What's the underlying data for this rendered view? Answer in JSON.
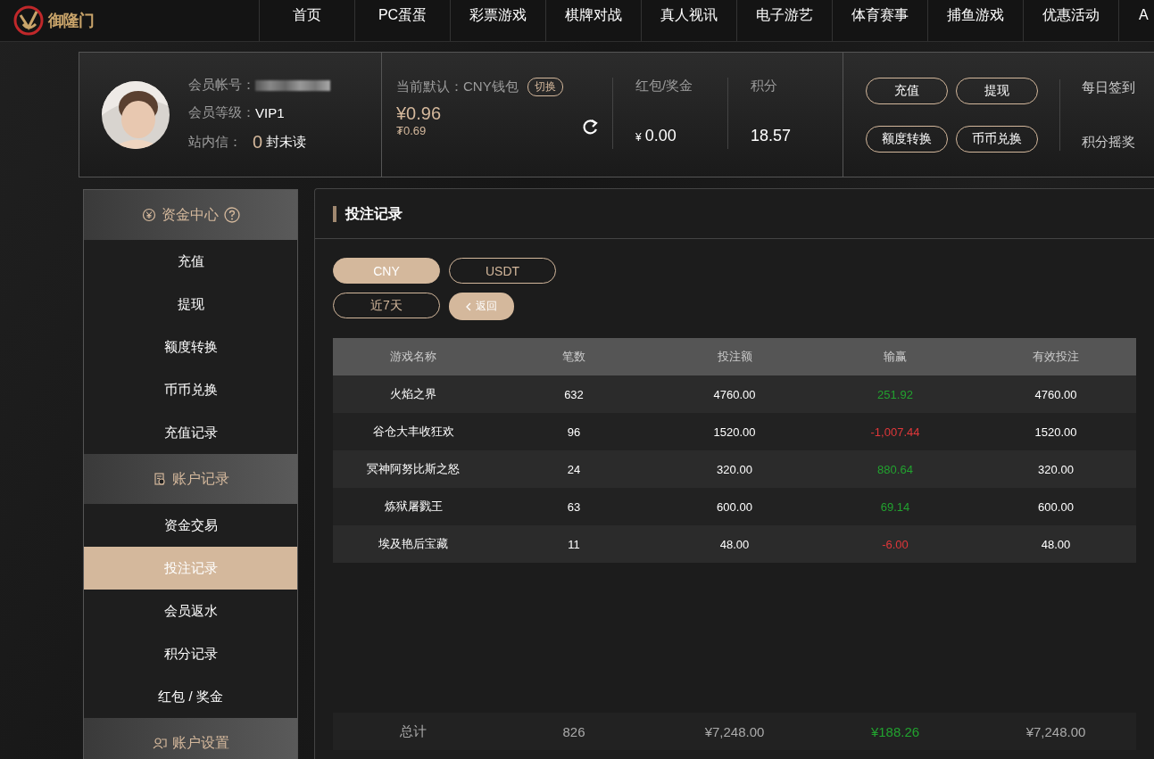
{
  "logo": {
    "text": "御隆门"
  },
  "nav": [
    {
      "label": "首页"
    },
    {
      "label": "PC蛋蛋"
    },
    {
      "label": "彩票游戏"
    },
    {
      "label": "棋牌对战"
    },
    {
      "label": "真人视讯"
    },
    {
      "label": "电子游艺"
    },
    {
      "label": "体育赛事"
    },
    {
      "label": "捕鱼游戏"
    },
    {
      "label": "优惠活动"
    },
    {
      "label": "A"
    }
  ],
  "profile": {
    "account_label": "会员帐号：",
    "level_label": "会员等级：",
    "level": "VIP1",
    "messages_label": "站内信：",
    "messages_count": "0",
    "messages_suffix": "封未读"
  },
  "wallet": {
    "label": "当前默认：CNY钱包",
    "switch": "切换",
    "balance": "¥0.96",
    "sub_balance": "₮0.69"
  },
  "bonus": {
    "label": "红包/奖金",
    "currency": "¥",
    "value": "0.00"
  },
  "points": {
    "label": "积分",
    "value": "18.57"
  },
  "actions": [
    "充值",
    "提现",
    "额度转换",
    "币币兑换"
  ],
  "links": [
    "每日签到",
    "积分摇奖"
  ],
  "sidebar": [
    {
      "kind": "header",
      "label": "资金中心"
    },
    {
      "kind": "item",
      "label": "充值",
      "selected": false
    },
    {
      "kind": "item",
      "label": "提现",
      "selected": false
    },
    {
      "kind": "item",
      "label": "额度转换",
      "selected": false
    },
    {
      "kind": "item",
      "label": "币币兑换",
      "selected": false
    },
    {
      "kind": "item",
      "label": "充值记录",
      "selected": false
    },
    {
      "kind": "header",
      "label": "账户记录"
    },
    {
      "kind": "item",
      "label": "资金交易",
      "selected": false
    },
    {
      "kind": "item",
      "label": "投注记录",
      "selected": true
    },
    {
      "kind": "item",
      "label": "会员返水",
      "selected": false
    },
    {
      "kind": "item",
      "label": "积分记录",
      "selected": false
    },
    {
      "kind": "item",
      "label": "红包 / 奖金",
      "selected": false
    },
    {
      "kind": "header",
      "label": "账户设置"
    }
  ],
  "panel": {
    "title": "投注记录",
    "currencies": [
      {
        "label": "CNY",
        "selected": true
      },
      {
        "label": "USDT",
        "selected": false
      }
    ],
    "period": "近7天",
    "back": "返回",
    "table": {
      "columns": [
        "游戏名称",
        "笔数",
        "投注额",
        "输赢",
        "有效投注"
      ],
      "rows": [
        {
          "cells": [
            "火焰之界",
            "632",
            "4760.00",
            "251.92",
            "4760.00"
          ],
          "color": "#22a22f"
        },
        {
          "cells": [
            "谷仓大丰收狂欢",
            "96",
            "1520.00",
            "-1,007.44",
            "1520.00"
          ],
          "color": "#e0373a"
        },
        {
          "cells": [
            "冥神阿努比斯之怒",
            "24",
            "320.00",
            "880.64",
            "320.00"
          ],
          "color": "#22a22f"
        },
        {
          "cells": [
            "炼狱屠戮王",
            "63",
            "600.00",
            "69.14",
            "600.00"
          ],
          "color": "#22a22f"
        },
        {
          "cells": [
            "埃及艳后宝藏",
            "11",
            "48.00",
            "-6.00",
            "48.00"
          ],
          "color": "#e0373a"
        }
      ],
      "total": {
        "cells": [
          "总计",
          "826",
          "¥7,248.00",
          "¥188.26",
          "¥7,248.00"
        ],
        "color": "#22a22f"
      }
    }
  }
}
